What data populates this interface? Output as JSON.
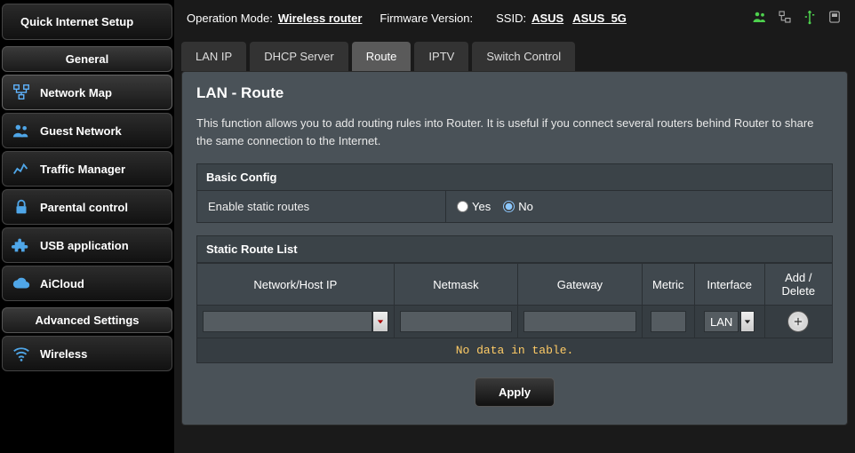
{
  "sidebar": {
    "quick_setup_label": "Quick Internet Setup",
    "general_header": "General",
    "advanced_header": "Advanced Settings",
    "items": [
      {
        "label": "Network Map"
      },
      {
        "label": "Guest Network"
      },
      {
        "label": "Traffic Manager"
      },
      {
        "label": "Parental control"
      },
      {
        "label": "USB application"
      },
      {
        "label": "AiCloud"
      }
    ],
    "advanced_items": [
      {
        "label": "Wireless"
      }
    ]
  },
  "topbar": {
    "op_mode_label": "Operation Mode:",
    "op_mode_value": "Wireless router",
    "fw_label": "Firmware Version:",
    "ssid_label": "SSID:",
    "ssid_values": [
      "ASUS",
      "ASUS_5G"
    ]
  },
  "tabs": [
    {
      "label": "LAN IP"
    },
    {
      "label": "DHCP Server"
    },
    {
      "label": "Route",
      "active": true
    },
    {
      "label": "IPTV"
    },
    {
      "label": "Switch Control"
    }
  ],
  "page": {
    "title": "LAN - Route",
    "description": "This function allows you to add routing rules into Router. It is useful if you connect several routers behind Router to share the same connection to the Internet.",
    "basic_config_header": "Basic Config",
    "enable_label": "Enable static routes",
    "yes": "Yes",
    "no": "No",
    "enable_value": "No",
    "route_list_header": "Static Route List",
    "columns": {
      "network": "Network/Host IP",
      "netmask": "Netmask",
      "gateway": "Gateway",
      "metric": "Metric",
      "interface": "Interface",
      "add_delete": "Add / Delete"
    },
    "interface_value": "LAN",
    "no_data": "No data in table.",
    "apply": "Apply"
  }
}
